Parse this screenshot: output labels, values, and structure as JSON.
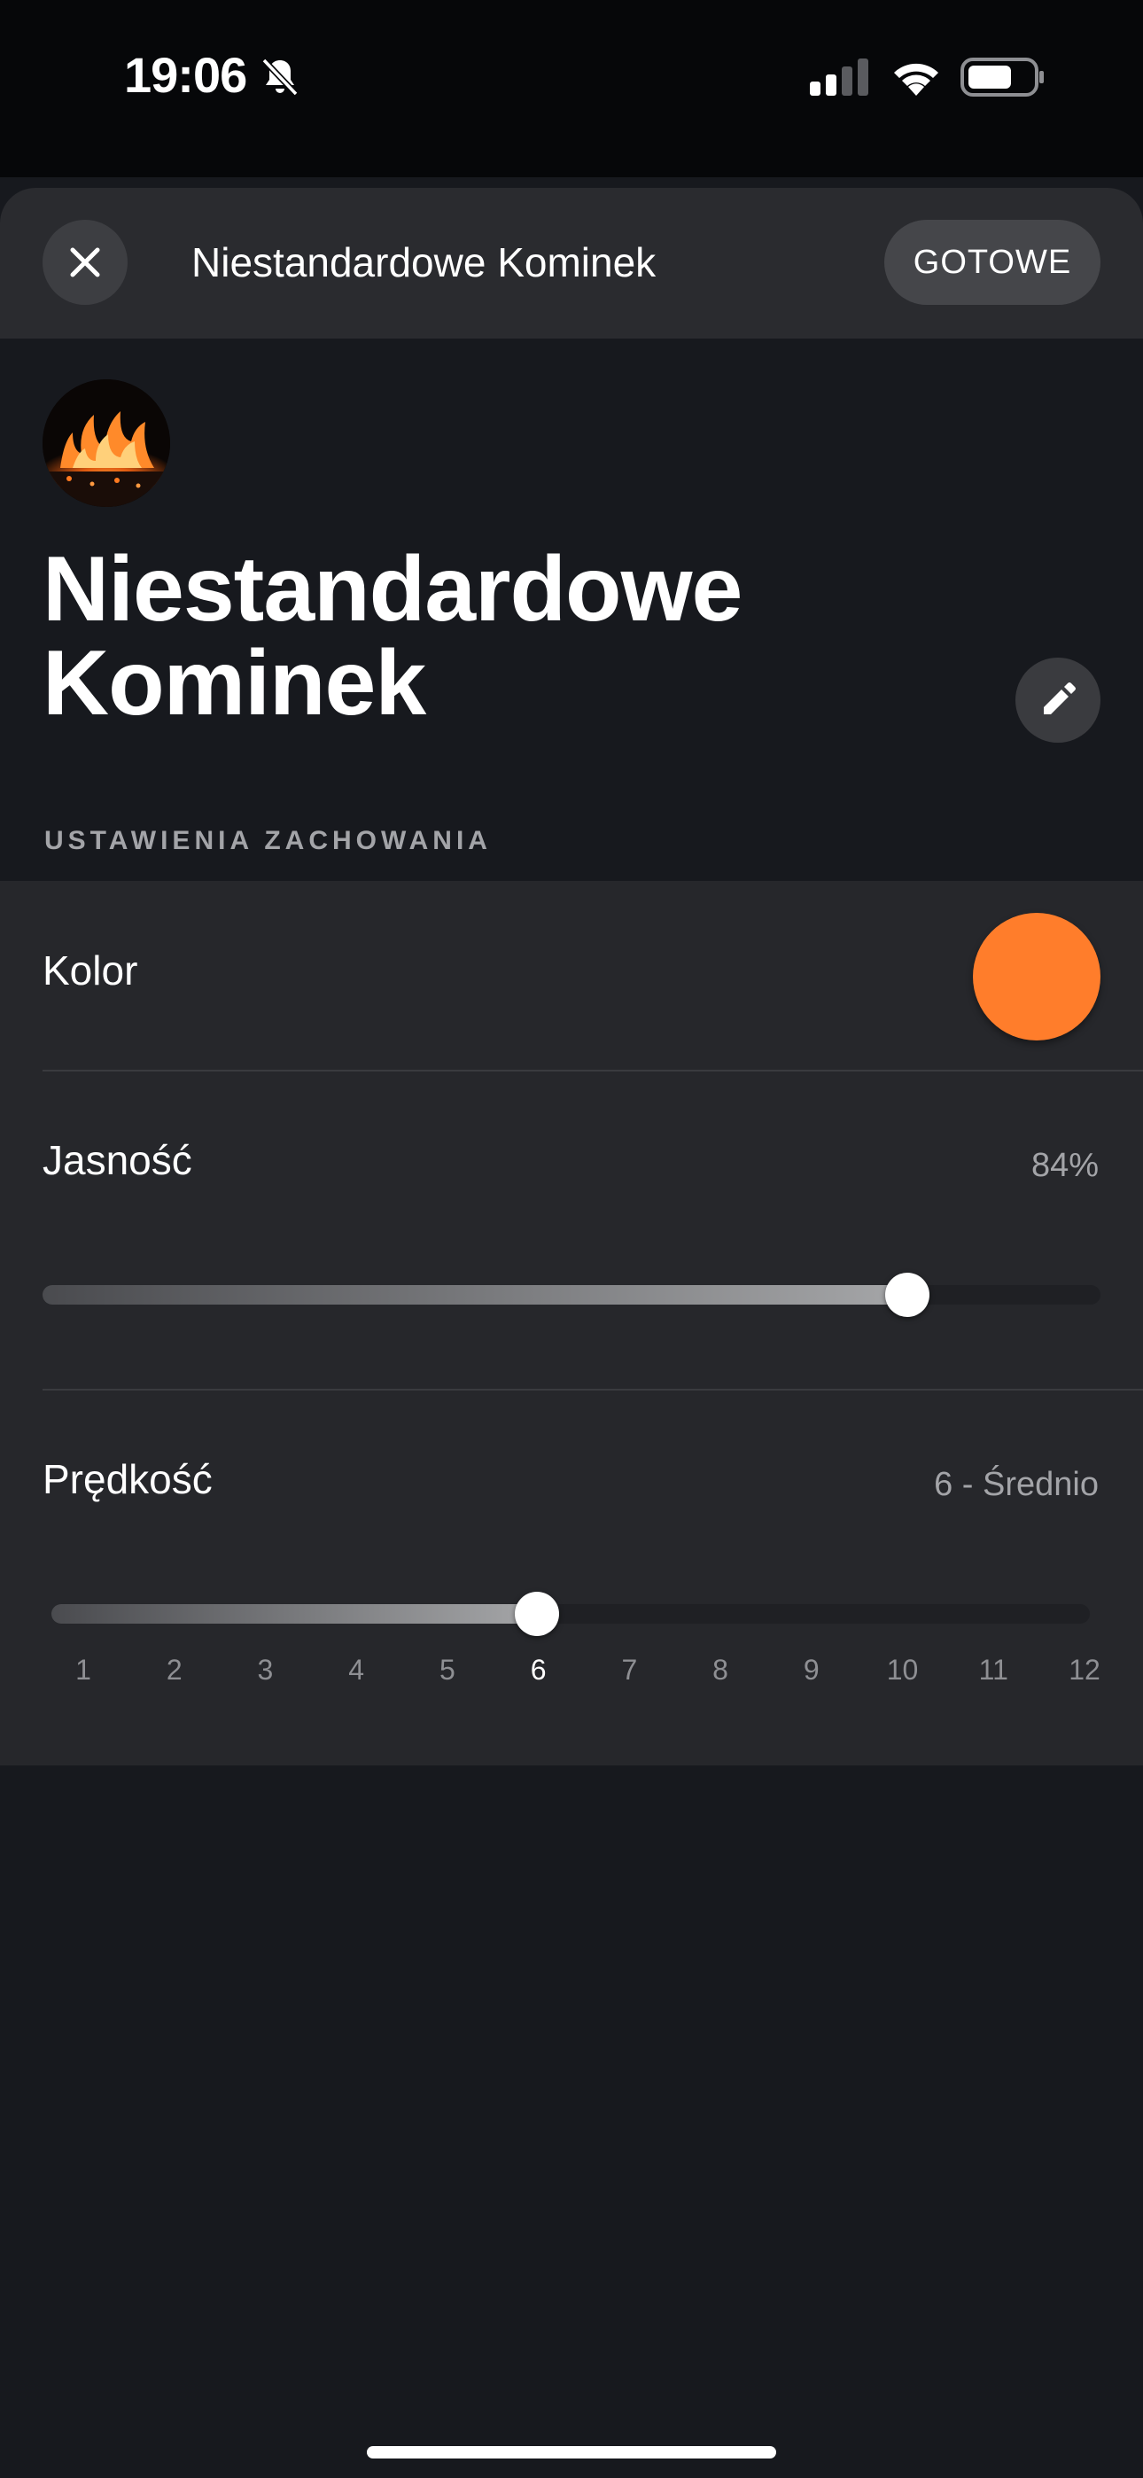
{
  "status_bar": {
    "time": "19:06",
    "icons": [
      "bell-slash-icon",
      "signal-icon",
      "wifi-icon",
      "battery-icon"
    ]
  },
  "header": {
    "title": "Niestandardowe Kominek",
    "done_label": "GOTOWE",
    "close_icon": "close-icon"
  },
  "profile": {
    "avatar_icon": "fireplace-flame-image",
    "title_line1": "Niestandardowe",
    "title_line2": "Kominek",
    "edit_icon": "pencil-icon"
  },
  "section_header": "USTAWIENIA ZACHOWANIA",
  "settings": {
    "color": {
      "label": "Kolor",
      "value_hex": "#ff7d2b"
    },
    "brightness": {
      "label": "Jasność",
      "value_text": "84%",
      "value": 0.84
    },
    "speed": {
      "label": "Prędkość",
      "value_text": "6 - Średnio",
      "value": 6,
      "min": 1,
      "max": 12,
      "ticks": [
        "1",
        "2",
        "3",
        "4",
        "5",
        "6",
        "7",
        "8",
        "9",
        "10",
        "11",
        "12"
      ]
    }
  },
  "colors": {
    "accent": "#ff7d2b",
    "background": "#17191e",
    "card": "#26272b"
  }
}
